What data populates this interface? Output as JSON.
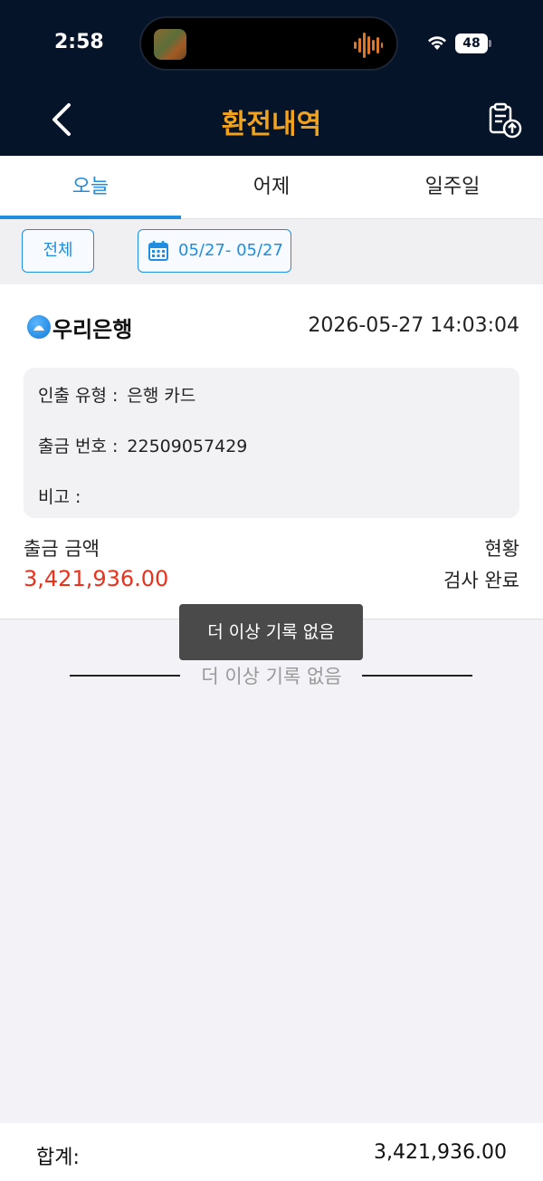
{
  "status_bar": {
    "time": "2:58",
    "battery": "48"
  },
  "header": {
    "title": "환전내역",
    "back_icon": "chevron-left-icon",
    "export_icon": "clipboard-upload-icon",
    "title_color": "#f2a21b",
    "background": "#06142a"
  },
  "tabs": [
    {
      "label": "오늘",
      "active": true
    },
    {
      "label": "어제",
      "active": false
    },
    {
      "label": "일주일",
      "active": false
    }
  ],
  "filters": {
    "all_label": "전체",
    "date_range": "05/27- 05/27",
    "calendar_icon": "calendar-icon"
  },
  "record": {
    "bank_name": "우리은행",
    "datetime": "2026-05-27 14:03:04",
    "details": [
      {
        "label": "인출 유형 :",
        "value": "은행 카드"
      },
      {
        "label": "출금 번호 :",
        "value": "22509057429"
      },
      {
        "label": "비고 :",
        "value": ""
      }
    ],
    "amount_label": "출금 금액",
    "amount": "3,421,936.00",
    "status_label": "현황",
    "status": "검사 완료",
    "amount_color": "#e8321c"
  },
  "toast": "더 이상 기록 없음",
  "end_of_list": "더 이상 기록 없음",
  "footer": {
    "total_label": "합계:",
    "total_value": "3,421,936.00"
  },
  "accent_color": "#1f8de0"
}
